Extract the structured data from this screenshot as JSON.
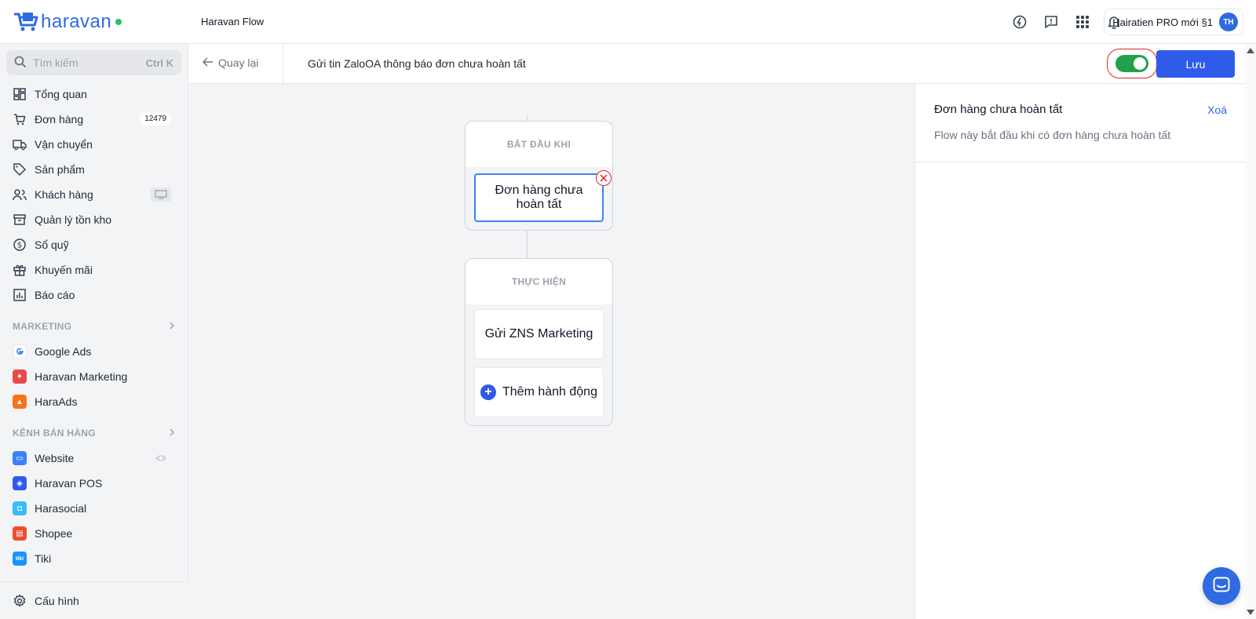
{
  "topbar": {
    "logo_text": "haravan",
    "app_name": "Haravan Flow",
    "account_name": "Hairatien PRO mới §1",
    "avatar_initials": "TH"
  },
  "search": {
    "placeholder": "Tìm kiếm",
    "shortcut": "Ctrl K"
  },
  "nav": {
    "items": [
      {
        "label": "Tổng quan",
        "icon": "dashboard-icon"
      },
      {
        "label": "Đơn hàng",
        "icon": "cart-icon",
        "badge": "12479"
      },
      {
        "label": "Vận chuyển",
        "icon": "truck-icon"
      },
      {
        "label": "Sản phẩm",
        "icon": "tag-icon"
      },
      {
        "label": "Khách hàng",
        "icon": "users-icon"
      },
      {
        "label": "Quản lý tồn kho",
        "icon": "archive-icon"
      },
      {
        "label": "Sổ quỹ",
        "icon": "dollar-icon"
      },
      {
        "label": "Khuyến mãi",
        "icon": "gift-icon"
      },
      {
        "label": "Báo cáo",
        "icon": "report-icon"
      }
    ],
    "marketing_title": "MARKETING",
    "marketing_items": [
      {
        "label": "Google Ads",
        "icon": "google-icon"
      },
      {
        "label": "Haravan Marketing",
        "icon": "haravan-marketing-icon"
      },
      {
        "label": "HaraAds",
        "icon": "haraads-icon"
      }
    ],
    "channels_title": "KÊNH BÁN HÀNG",
    "channel_items": [
      {
        "label": "Website",
        "icon": "website-icon"
      },
      {
        "label": "Haravan POS",
        "icon": "pos-icon"
      },
      {
        "label": "Harasocial",
        "icon": "harasocial-icon"
      },
      {
        "label": "Shopee",
        "icon": "shopee-icon"
      },
      {
        "label": "Tiki",
        "icon": "tiki-icon"
      }
    ],
    "config_label": "Cấu hình"
  },
  "subheader": {
    "back_label": "Quay lại",
    "flow_title": "Gửi tin ZaloOA thông báo đơn chưa hoàn tất",
    "toggle_on": true,
    "save_label": "Lưu"
  },
  "flow": {
    "start_header": "BẮT ĐẦU KHI",
    "trigger_node": "Đơn hàng chưa hoàn tất",
    "action_header": "THỰC HIỆN",
    "action_node": "Gửi ZNS Marketing",
    "add_action_label": "Thêm hành động"
  },
  "panel": {
    "title": "Đơn hàng chưa hoàn tất",
    "delete_label": "Xoá",
    "description": "Flow này bắt đầu khi có đơn hàng chưa hoàn tất"
  },
  "colors": {
    "brand": "#2f6ae3",
    "save_button": "#2f5bea",
    "toggle_on": "#22a04b",
    "highlight_ring": "#dc2626"
  }
}
